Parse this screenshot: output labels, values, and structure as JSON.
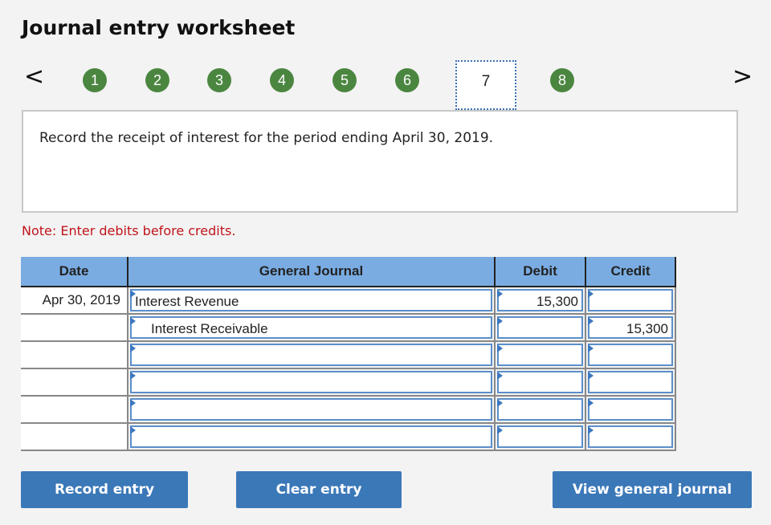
{
  "title": "Journal entry worksheet",
  "nav": {
    "prev": "<",
    "next": ">",
    "steps": [
      "1",
      "2",
      "3",
      "4",
      "5",
      "6",
      "7",
      "8"
    ],
    "current": "7"
  },
  "prompt": "Record the receipt of interest for the period ending April 30, 2019.",
  "note": "Note: Enter debits before credits.",
  "table": {
    "headers": [
      "Date",
      "General Journal",
      "Debit",
      "Credit"
    ],
    "rows": [
      {
        "date": "Apr 30, 2019",
        "account": "Interest Revenue",
        "debit": "15,300",
        "credit": "",
        "indent": false
      },
      {
        "date": "",
        "account": "Interest Receivable",
        "debit": "",
        "credit": "15,300",
        "indent": true
      },
      {
        "date": "",
        "account": "",
        "debit": "",
        "credit": ""
      },
      {
        "date": "",
        "account": "",
        "debit": "",
        "credit": ""
      },
      {
        "date": "",
        "account": "",
        "debit": "",
        "credit": ""
      },
      {
        "date": "",
        "account": "",
        "debit": "",
        "credit": ""
      }
    ]
  },
  "buttons": {
    "record": "Record entry",
    "clear": "Clear entry",
    "view": "View general journal"
  },
  "colors": {
    "step_green": "#4b8640",
    "header_blue": "#7aace2",
    "button_blue": "#3b78b8",
    "note_red": "#c0141b"
  }
}
